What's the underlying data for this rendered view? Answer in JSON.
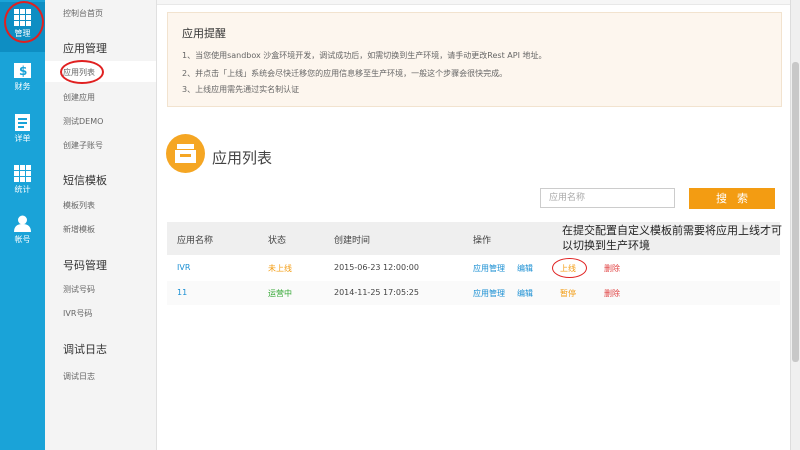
{
  "rail": {
    "items": [
      {
        "label": "管理",
        "icon": "grid-icon"
      },
      {
        "label": "财务",
        "icon": "dollar-card-icon"
      },
      {
        "label": "详单",
        "icon": "receipt-icon"
      },
      {
        "label": "统计",
        "icon": "grid-icon"
      },
      {
        "label": "帐号",
        "icon": "user-icon"
      }
    ]
  },
  "sidebar": {
    "top_link": "控制台首页",
    "groups": [
      {
        "title": "应用管理",
        "items": [
          "应用列表",
          "创建应用",
          "测试DEMO",
          "创建子账号"
        ]
      },
      {
        "title": "短信模板",
        "items": [
          "模板列表",
          "新增模板"
        ]
      },
      {
        "title": "号码管理",
        "items": [
          "测试号码",
          "IVR号码"
        ]
      },
      {
        "title": "调试日志",
        "items": [
          "调试日志"
        ]
      }
    ]
  },
  "notice": {
    "title": "应用提醒",
    "lines": [
      "1、当您使用sandbox 沙盒环境开发，调试成功后，如需切换到生产环境，请手动更改Rest API 地址。",
      "2、并点击「上线」系统会尽快迁移您的应用信息移至生产环境，一般这个步骤会很快完成。",
      "3、上线应用需先通过实名制认证"
    ]
  },
  "list": {
    "title": "应用列表",
    "search_placeholder": "应用名称",
    "search_button": "搜索",
    "headers": [
      "应用名称",
      "状态",
      "创建时间",
      "操作"
    ],
    "rows": [
      {
        "name": "IVR",
        "status": "未上线",
        "created": "2015-06-23 12:00:00",
        "manage": "应用管理",
        "edit": "编辑",
        "toggle": "上线",
        "delete": "删除"
      },
      {
        "name": "11",
        "status": "运营中",
        "created": "2014-11-25 17:05:25",
        "manage": "应用管理",
        "edit": "编辑",
        "toggle": "暂停",
        "delete": "删除"
      }
    ]
  },
  "annotation": "在提交配置自定义模板前需要将应用上线才可以切换到生产环境",
  "colors": {
    "rail": "#1aa3d8",
    "accent": "#f39c12",
    "link": "#1a8fd3",
    "running": "#35a835",
    "delete": "#e04040",
    "highlight_circle": "#e02020"
  }
}
